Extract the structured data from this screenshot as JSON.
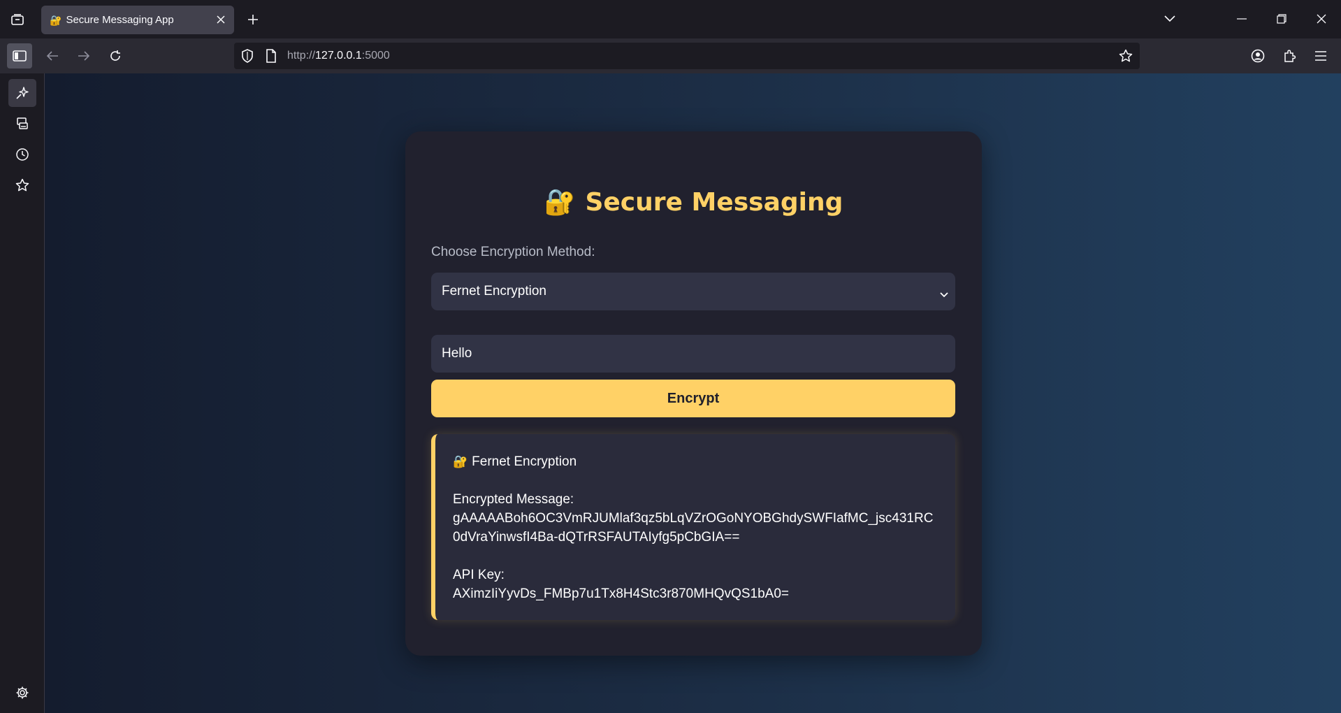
{
  "browser": {
    "tab": {
      "favicon": "🔐",
      "title": "Secure Messaging App"
    },
    "url": {
      "scheme": "http://",
      "host": "127.0.0.1",
      "port": ":5000"
    }
  },
  "page": {
    "heading_icon": "🔐",
    "heading": "Secure Messaging",
    "method_label": "Choose Encryption Method:",
    "method_selected": "Fernet Encryption",
    "message_value": "Hello",
    "encrypt_label": "Encrypt",
    "result": {
      "icon": "🔐",
      "title": "Fernet Encryption",
      "encrypted_label": "Encrypted Message:",
      "encrypted_value": "gAAAAABoh6OC3VmRJUMlaf3qz5bLqVZrOGoNYOBGhdySWFIafMC_jsc431RC0dVraYinwsfI4Ba-dQTrRSFAUTAIyfg5pCbGIA==",
      "api_key_label": "API Key:",
      "api_key_value": "AXimzIiYyvDs_FMBp7u1Tx8H4Stc3r870MHQvQS1bA0="
    }
  },
  "colors": {
    "accent": "#ffd166",
    "card": "#21212e",
    "field": "#313345"
  }
}
